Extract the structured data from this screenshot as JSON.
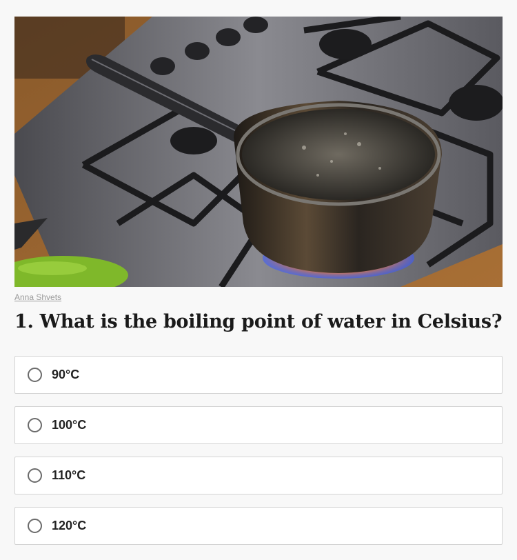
{
  "photo": {
    "alt_icon": "cooking-pot-on-gas-stove-photo",
    "credit": "Anna Shvets"
  },
  "quiz": {
    "question": "1. What is the boiling point of water in Celsius?",
    "options": [
      {
        "label": "90°C"
      },
      {
        "label": "100°C"
      },
      {
        "label": "110°C"
      },
      {
        "label": "120°C"
      }
    ]
  }
}
